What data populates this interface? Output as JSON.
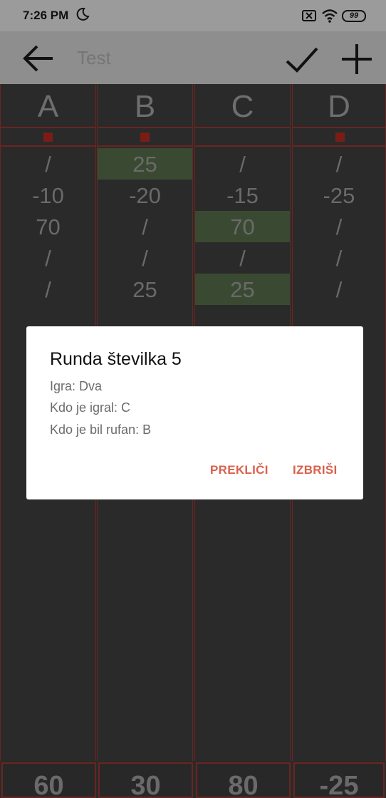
{
  "status_bar": {
    "time": "7:26 PM",
    "battery": "99"
  },
  "app_bar": {
    "title_placeholder": "Test"
  },
  "columns": [
    {
      "label": "A",
      "cells": [
        {
          "v": "/",
          "hl": false
        },
        {
          "v": "-10",
          "hl": false
        },
        {
          "v": "70",
          "hl": false
        },
        {
          "v": "/",
          "hl": false
        },
        {
          "v": "/",
          "hl": false
        }
      ],
      "total": "60"
    },
    {
      "label": "B",
      "cells": [
        {
          "v": "25",
          "hl": true
        },
        {
          "v": "-20",
          "hl": false
        },
        {
          "v": "/",
          "hl": false
        },
        {
          "v": "/",
          "hl": false
        },
        {
          "v": "25",
          "hl": false
        }
      ],
      "total": "30"
    },
    {
      "label": "C",
      "cells": [
        {
          "v": "/",
          "hl": false
        },
        {
          "v": "-15",
          "hl": false
        },
        {
          "v": "70",
          "hl": true
        },
        {
          "v": "/",
          "hl": false
        },
        {
          "v": "25",
          "hl": true
        }
      ],
      "total": "80"
    },
    {
      "label": "D",
      "cells": [
        {
          "v": "/",
          "hl": false
        },
        {
          "v": "-25",
          "hl": false
        },
        {
          "v": "/",
          "hl": false
        },
        {
          "v": "/",
          "hl": false
        },
        {
          "v": "/",
          "hl": false
        }
      ],
      "total": "-25"
    }
  ],
  "dialog": {
    "title": "Runda številka 5",
    "game_line": "Igra: Dva",
    "player_line": "Kdo je igral: C",
    "rufan_line": "Kdo je bil rufan: B",
    "cancel_label": "PREKLIČI",
    "delete_label": "IZBRIŠI"
  },
  "colors": {
    "accent": "#d9614b",
    "grid_line": "#6b2520",
    "highlight": "#3a4a32"
  }
}
